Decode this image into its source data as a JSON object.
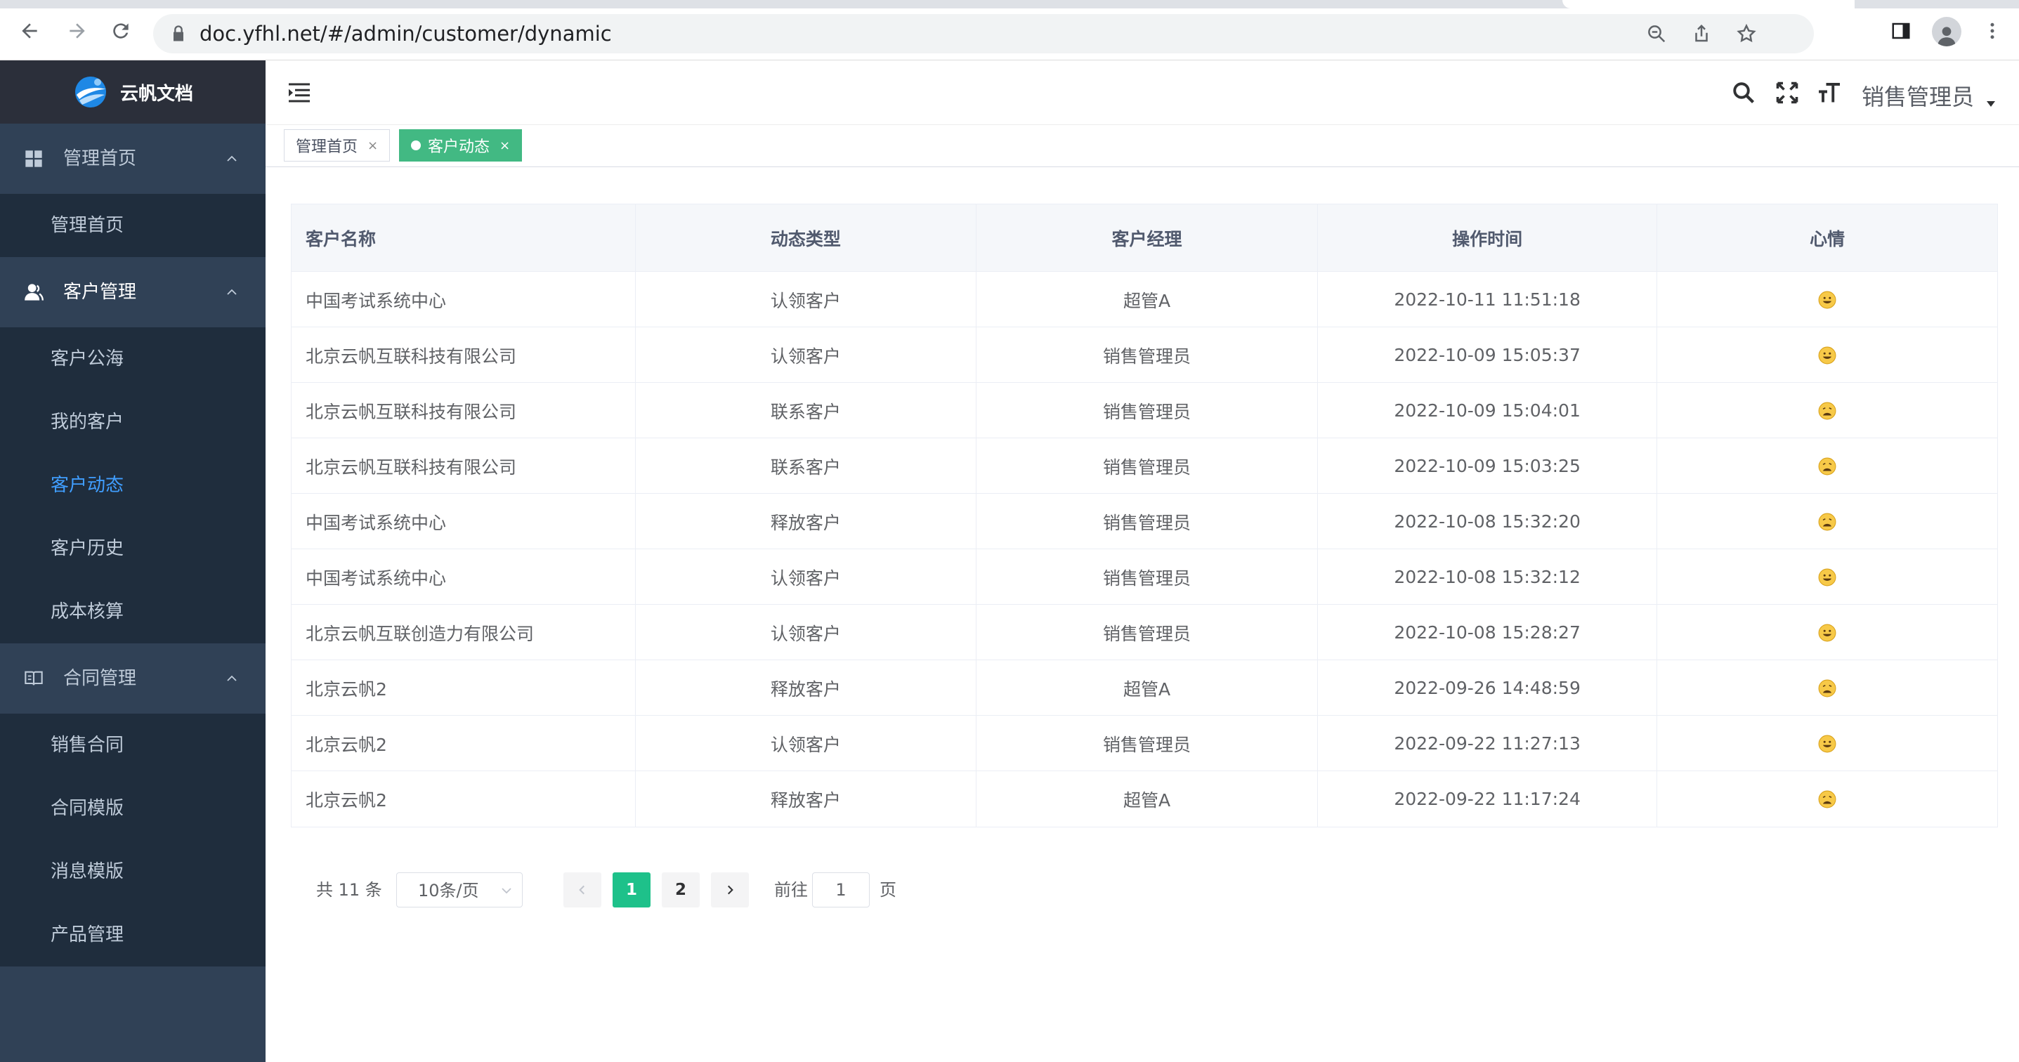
{
  "browser": {
    "url": "doc.yfhl.net/#/admin/customer/dynamic"
  },
  "sidebar": {
    "logo_text": "云帆文档",
    "groups": [
      {
        "label": "管理首页",
        "icon": "dashboard-icon",
        "items": [
          {
            "label": "管理首页"
          }
        ]
      },
      {
        "label": "客户管理",
        "icon": "user-icon",
        "items": [
          {
            "label": "客户公海"
          },
          {
            "label": "我的客户"
          },
          {
            "label": "客户动态",
            "active": true
          },
          {
            "label": "客户历史"
          },
          {
            "label": "成本核算"
          }
        ]
      },
      {
        "label": "合同管理",
        "icon": "book-icon",
        "items": [
          {
            "label": "销售合同"
          },
          {
            "label": "合同模版"
          },
          {
            "label": "消息模版"
          },
          {
            "label": "产品管理"
          }
        ]
      }
    ]
  },
  "header": {
    "user_name": "销售管理员"
  },
  "tags": [
    {
      "label": "管理首页",
      "active": false
    },
    {
      "label": "客户动态",
      "active": true
    }
  ],
  "table": {
    "columns": [
      "客户名称",
      "动态类型",
      "客户经理",
      "操作时间",
      "心情"
    ],
    "rows": [
      {
        "name": "中国考试系统中心",
        "type": "认领客户",
        "manager": "超管A",
        "time": "2022-10-11 11:51:18",
        "mood": "happy"
      },
      {
        "name": "北京云帆互联科技有限公司",
        "type": "认领客户",
        "manager": "销售管理员",
        "time": "2022-10-09 15:05:37",
        "mood": "happy"
      },
      {
        "name": "北京云帆互联科技有限公司",
        "type": "联系客户",
        "manager": "销售管理员",
        "time": "2022-10-09 15:04:01",
        "mood": "weary"
      },
      {
        "name": "北京云帆互联科技有限公司",
        "type": "联系客户",
        "manager": "销售管理员",
        "time": "2022-10-09 15:03:25",
        "mood": "weary"
      },
      {
        "name": "中国考试系统中心",
        "type": "释放客户",
        "manager": "销售管理员",
        "time": "2022-10-08 15:32:20",
        "mood": "weary"
      },
      {
        "name": "中国考试系统中心",
        "type": "认领客户",
        "manager": "销售管理员",
        "time": "2022-10-08 15:32:12",
        "mood": "happy"
      },
      {
        "name": "北京云帆互联创造力有限公司",
        "type": "认领客户",
        "manager": "销售管理员",
        "time": "2022-10-08 15:28:27",
        "mood": "happy"
      },
      {
        "name": "北京云帆2",
        "type": "释放客户",
        "manager": "超管A",
        "time": "2022-09-26 14:48:59",
        "mood": "weary"
      },
      {
        "name": "北京云帆2",
        "type": "认领客户",
        "manager": "销售管理员",
        "time": "2022-09-22 11:27:13",
        "mood": "happy"
      },
      {
        "name": "北京云帆2",
        "type": "释放客户",
        "manager": "超管A",
        "time": "2022-09-22 11:17:24",
        "mood": "weary"
      }
    ]
  },
  "pagination": {
    "total_label": "共 11 条",
    "page_size": "10条/页",
    "pages": [
      "1",
      "2"
    ],
    "current": "1",
    "goto_label": "前往",
    "goto_value": "1",
    "page_unit": "页"
  },
  "colors": {
    "sidebar_bg": "#304156",
    "submenu_bg": "#1f2d3d",
    "active_link": "#409eff",
    "tag_active": "#42b983",
    "page_active": "#1ec18a"
  }
}
